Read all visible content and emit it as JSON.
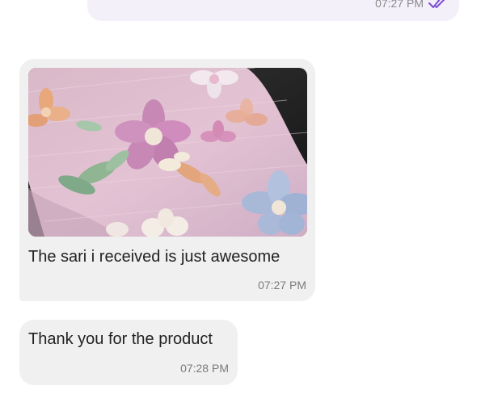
{
  "messages": [
    {
      "direction": "outgoing",
      "time": "07:27 PM",
      "status_icon": "double-check-icon",
      "status_color": "#7b4fd6"
    },
    {
      "direction": "incoming",
      "image": "pink-floral-sari-photo",
      "text": "The sari i received is just awesome",
      "time": "07:27 PM"
    },
    {
      "direction": "incoming",
      "text": "Thank you for the product",
      "time": "07:28 PM"
    }
  ],
  "colors": {
    "incoming_bubble": "#f0f0f0",
    "outgoing_bubble": "#f4f0fa",
    "text": "#222222",
    "timestamp": "#7b7b7b"
  }
}
